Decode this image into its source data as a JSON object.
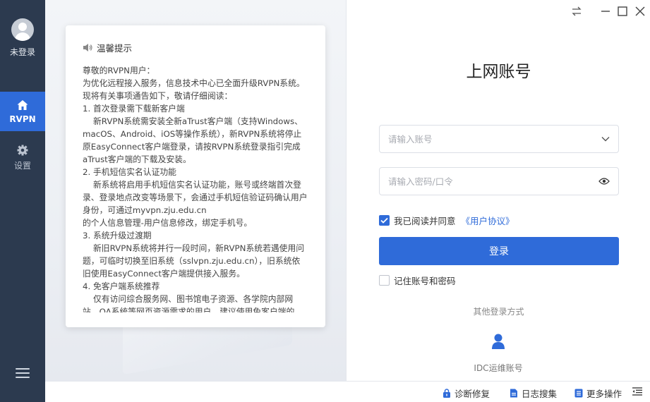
{
  "sidebar": {
    "user_label": "未登录",
    "items": [
      {
        "label": "RVPN",
        "icon": "home-icon",
        "active": true
      },
      {
        "label": "设置",
        "icon": "gear-icon",
        "active": false
      }
    ],
    "menu_icon": "hamburger-menu-icon"
  },
  "notice": {
    "heading": "温馨提示",
    "body": "尊敬的RVPN用户：\n为优化远程接入服务，信息技术中心已全面升级RVPN系统。现将有关事项通告如下，敬请仔细阅读：\n1. 首次登录需下载新客户端\n    新RVPN系统需安装全新aTrust客户端（支持Windows、macOS、Android、iOS等操作系统），新RVPN系统将停止原EasyConnect客户端登录，请按RVPN系统登录指引完成aTrust客户端的下载及安装。\n2. 手机短信实名认证功能\n    新系统将启用手机短信实名认证功能，账号或终端首次登录、登录地点改变等场景下，会通过手机短信验证码确认用户身份，可通过myvpn.zju.edu.cn\n的个人信息管理-用户信息修改，绑定手机号。\n3. 系统升级过渡期\n    新旧RVPN系统将并行一段时间，新RVPN系统若遇使用问题，可临时切换至旧系统（sslvpn.zju.edu.cn），旧系统依旧使用EasyConnect客户端提供接入服务。\n4. 免客户端系统推荐\n    仅有访问综合服务网、图书馆电子资源、各学院内部网站、OA系统等网页资源需求的用户，建议使用免客户端的"
  },
  "login": {
    "title": "上网账号",
    "account_placeholder": "请输入账号",
    "account_value": "",
    "password_placeholder": "请输入密码/口令",
    "password_value": "",
    "agree_checked": true,
    "agree_text": "我已阅读并同意",
    "agreement_link": "《用户协议》",
    "login_button": "登录",
    "remember_checked": false,
    "remember_text": "记住账号和密码",
    "other_methods": "其他登录方式",
    "idc_label": "IDC运维账号"
  },
  "statusbar": {
    "diagnose": "诊断修复",
    "log": "日志搜集",
    "more": "更多操作"
  },
  "colors": {
    "sidebar_bg": "#2c3a4f",
    "accent": "#2f6bd9"
  }
}
